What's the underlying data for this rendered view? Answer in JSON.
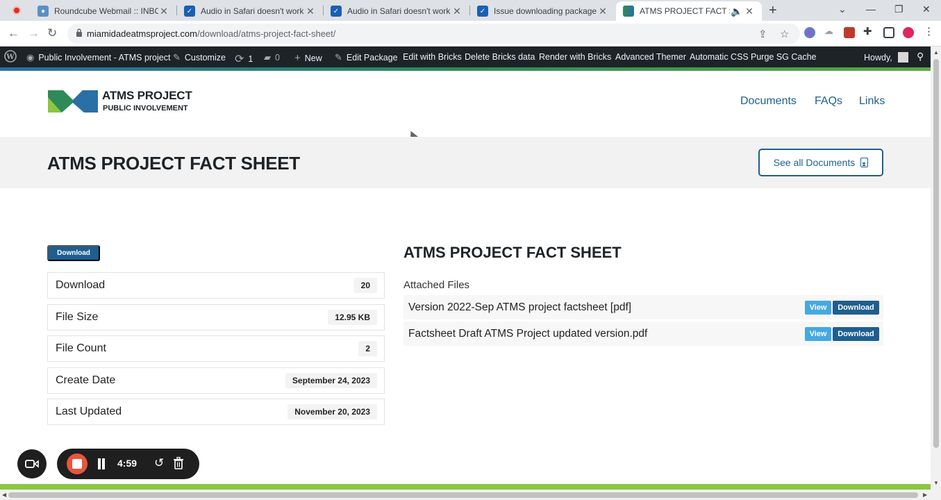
{
  "browser": {
    "tabs": [
      {
        "title": "Roundcube Webmail :: INBOX",
        "icon": "roundcube-icon",
        "active": false
      },
      {
        "title": "Audio in Safari doesn't work - W",
        "icon": "wpmet-icon",
        "active": false
      },
      {
        "title": "Audio in Safari doesn't work - W",
        "icon": "wpmet-icon",
        "active": false
      },
      {
        "title": "Issue downloading package with",
        "icon": "wpmet-icon",
        "active": false
      },
      {
        "title": "ATMS PROJECT FACT SHEET",
        "icon": "atms-icon",
        "active": true
      }
    ],
    "url_host": "miamidadeatmsproject.com",
    "url_path": "/download/atms-project-fact-sheet/"
  },
  "adminbar": {
    "site_name": "Public Involvement - ATMS project",
    "customize": "Customize",
    "updates_count": "1",
    "comments_count": "0",
    "new": "New",
    "edit_package": "Edit Package",
    "edit_bricks": "Edit with Bricks",
    "delete_bricks": "Delete Bricks data",
    "render_bricks": "Render with Bricks",
    "advanced_themer": "Advanced Themer",
    "automatic_css": "Automatic CSS",
    "purge_cache": "Purge SG Cache",
    "howdy": "Howdy,"
  },
  "site": {
    "logo_line1": "ATMS PROJECT",
    "logo_line2": "PUBLIC INVOLVEMENT",
    "nav": [
      "Documents",
      "FAQs",
      "Links"
    ],
    "page_title": "ATMS PROJECT FACT SHEET",
    "see_all": "See all Documents"
  },
  "package": {
    "download_badge": "Download",
    "info": [
      {
        "label": "Download",
        "value": "20"
      },
      {
        "label": "File Size",
        "value": "12.95 KB"
      },
      {
        "label": "File Count",
        "value": "2"
      },
      {
        "label": "Create Date",
        "value": "September 24, 2023"
      },
      {
        "label": "Last Updated",
        "value": "November 20, 2023"
      }
    ],
    "title": "ATMS PROJECT FACT SHEET",
    "attached_label": "Attached Files",
    "files": [
      {
        "name": "Version 2022-Sep ATMS project factsheet [pdf]",
        "view": "View",
        "download": "Download"
      },
      {
        "name": "Factsheet Draft ATMS Project updated version.pdf",
        "view": "View",
        "download": "Download"
      }
    ]
  },
  "recorder": {
    "time": "4:59"
  },
  "colors": {
    "accent": "#1e5f8f",
    "view_button": "#45a9e0",
    "adminbar": "#1d2327"
  }
}
